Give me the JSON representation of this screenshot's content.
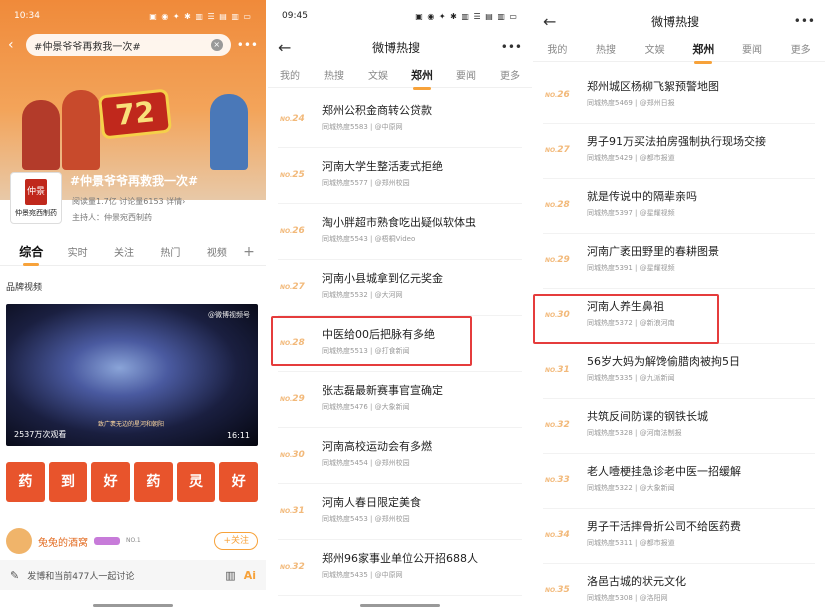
{
  "panel1": {
    "status_time": "10:34",
    "status_icons": "▣ ◉ ✦ ✱ ▥ ☰ ▤ ▥ ▭",
    "search_text": "#仲景爷爷再救我一次#",
    "poster_number": "72",
    "hashtag_title": "#仲景爷爷再救我一次#",
    "logo_name": "仲景宛西制药",
    "stats": "阅读量1.7亿  讨论量6153  详情›",
    "host": "主持人：仲景宛西制药",
    "tabs": [
      "综合",
      "实时",
      "关注",
      "热门",
      "视频"
    ],
    "section_label": "品牌视频",
    "video_watermark": "@微博视频号",
    "video_views": "2537万次观看",
    "video_duration": "16:11",
    "video_caption": "致广袤无边的星河和朝阳",
    "stickers": [
      "药",
      "到",
      "好",
      "药",
      "灵",
      "好"
    ],
    "user_name": "兔兔的酒窝",
    "user_tag": "NO.1",
    "follow_label": "+关注",
    "comment_placeholder": "发博和当前477人一起讨论",
    "ai_label": "Ai"
  },
  "panel2": {
    "status_time": "09:45",
    "status_icons": "▣ ◉ ✦ ✱ ▥ ☰ ▤ ▥ ▭",
    "title": "微博热搜",
    "tabs": [
      "我的",
      "热搜",
      "文娱",
      "郑州",
      "要闻",
      "更多"
    ],
    "active_tab": "郑州",
    "items": [
      {
        "rank": "24",
        "title": "郑州公积金商转公贷款",
        "meta": "同城热度5583 | @中原网"
      },
      {
        "rank": "25",
        "title": "河南大学生整活麦式拒绝",
        "meta": "同城热度5577 | @郑州校园"
      },
      {
        "rank": "26",
        "title": "淘小胖超市熟食吃出疑似软体虫",
        "meta": "同城热度5543 | @梧桐Video"
      },
      {
        "rank": "27",
        "title": "河南小县城拿到亿元奖金",
        "meta": "同城热度5532 | @大河网"
      },
      {
        "rank": "28",
        "title": "中医给00后把脉有多绝",
        "meta": "同城热度5513 | @打食新闻"
      },
      {
        "rank": "29",
        "title": "张志磊最新赛事官宣确定",
        "meta": "同城热度5476 | @大象新闻"
      },
      {
        "rank": "30",
        "title": "河南高校运动会有多燃",
        "meta": "同城热度5454 | @郑州校园"
      },
      {
        "rank": "31",
        "title": "河南人春日限定美食",
        "meta": "同城热度5453 | @郑州校园"
      },
      {
        "rank": "32",
        "title": "郑州96家事业单位公开招688人",
        "meta": "同城热度5435 | @中原网"
      }
    ]
  },
  "panel3": {
    "title": "微博热搜",
    "tabs": [
      "我的",
      "热搜",
      "文娱",
      "郑州",
      "要闻",
      "更多"
    ],
    "active_tab": "郑州",
    "items": [
      {
        "rank": "26",
        "title": "郑州城区杨柳飞絮预警地图",
        "meta": "同城热度5469 | @郑州日报"
      },
      {
        "rank": "27",
        "title": "男子91万买法拍房强制执行现场交接",
        "meta": "同城热度5429 | @都市报道"
      },
      {
        "rank": "28",
        "title": "就是传说中的隔辈亲吗",
        "meta": "同城热度5397 | @星耀视频"
      },
      {
        "rank": "29",
        "title": "河南广袤田野里的春耕图景",
        "meta": "同城热度5391 | @星耀视频"
      },
      {
        "rank": "30",
        "title": "河南人养生鼻祖",
        "meta": "同城热度5372 | @新浪河南"
      },
      {
        "rank": "31",
        "title": "56岁大妈为解馋偷腊肉被拘5日",
        "meta": "同城热度5335 | @九派新闻"
      },
      {
        "rank": "32",
        "title": "共筑反间防谍的钢铁长城",
        "meta": "同城热度5328 | @河南法制报"
      },
      {
        "rank": "33",
        "title": "老人噎梗挂急诊老中医一招缓解",
        "meta": "同城热度5322 | @大象新闻"
      },
      {
        "rank": "34",
        "title": "男子干活摔骨折公司不给医药费",
        "meta": "同城热度5311 | @都市报道"
      },
      {
        "rank": "35",
        "title": "洛邑古城的状元文化",
        "meta": "同城热度5308 | @洛阳网"
      }
    ]
  },
  "rank_prefix": "NO.",
  "colors": {
    "accent": "#f7a23a",
    "highlight": "#e53c3c",
    "rank": "#f2b97a"
  }
}
